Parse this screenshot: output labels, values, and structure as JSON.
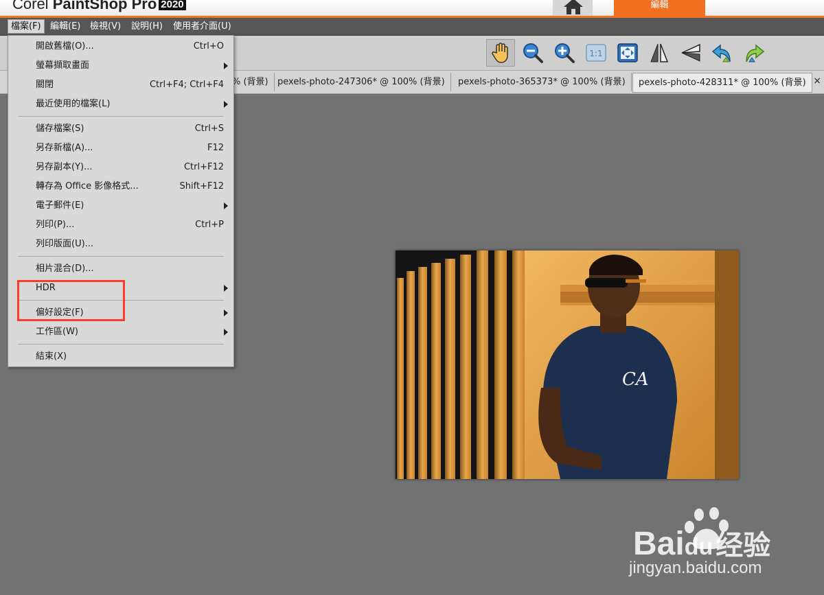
{
  "app": {
    "brand": "Corel",
    "product": "PaintShop Pro",
    "year": "2020",
    "edit_tab_label": "編輯",
    "accent_color": "#f37021"
  },
  "menubar": {
    "items": [
      {
        "label": "檔案(F)"
      },
      {
        "label": "編輯(E)"
      },
      {
        "label": "檢視(V)"
      },
      {
        "label": "說明(H)"
      },
      {
        "label": "使用者介面(U)"
      }
    ]
  },
  "toolbar": {
    "icons": [
      "pan-hand-icon",
      "zoom-out-icon",
      "zoom-in-icon",
      "actual-size-icon",
      "fit-to-window-icon",
      "flip-horizontal-icon",
      "flip-vertical-icon",
      "rotate-left-icon",
      "rotate-right-icon"
    ]
  },
  "doctabs": {
    "tabs": [
      {
        "label": "% (背景)"
      },
      {
        "label": "pexels-photo-247306* @ 100% (背景)"
      },
      {
        "label": "pexels-photo-365373* @ 100% (背景)"
      },
      {
        "label": "pexels-photo-428311* @ 100% (背景)"
      }
    ],
    "close_glyph": "×"
  },
  "file_menu": {
    "items": [
      {
        "label": "開啟舊檔(O)...",
        "shortcut": "Ctrl+O"
      },
      {
        "label": "螢幕擷取畫面",
        "shortcut": ""
      },
      {
        "label": "關閉",
        "shortcut": "Ctrl+F4; Ctrl+F4"
      },
      {
        "label": "最近使用的檔案(L)",
        "shortcut": ""
      },
      {
        "label": "儲存檔案(S)",
        "shortcut": "Ctrl+S"
      },
      {
        "label": "另存新檔(A)...",
        "shortcut": "F12"
      },
      {
        "label": "另存副本(Y)...",
        "shortcut": "Ctrl+F12"
      },
      {
        "label": "轉存為 Office 影像格式...",
        "shortcut": "Shift+F12"
      },
      {
        "label": "電子郵件(E)",
        "shortcut": ""
      },
      {
        "label": "列印(P)...",
        "shortcut": "Ctrl+P"
      },
      {
        "label": "列印版面(U)...",
        "shortcut": ""
      },
      {
        "label": "相片混合(D)...",
        "shortcut": ""
      },
      {
        "label": "HDR",
        "shortcut": ""
      },
      {
        "label": "偏好設定(F)",
        "shortcut": ""
      },
      {
        "label": "工作區(W)",
        "shortcut": ""
      },
      {
        "label": "結束(X)",
        "shortcut": ""
      }
    ]
  },
  "photo": {
    "shirt_text": "CA"
  },
  "watermark": {
    "brand": "Bai",
    "brand2": "du",
    "cn": "经验",
    "url": "jingyan.baidu.com"
  }
}
